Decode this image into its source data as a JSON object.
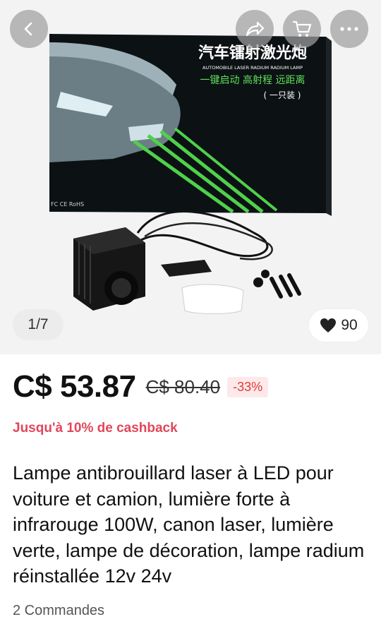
{
  "gallery": {
    "counter": "1/7",
    "likes": "90",
    "box_title_cn": "汽车镭射激光炮",
    "box_subtitle_en": "AUTOMOBILE LASER RADIUM RADIUM LAMP",
    "box_line2_cn": "一键启动 高射程 远距离",
    "box_line3_cn": "( 一只装 )",
    "box_cert": "FC CE RoHS"
  },
  "price": {
    "current": "C$ 53.87",
    "original": "C$ 80.40",
    "discount": "-33%"
  },
  "cashback": "Jusqu'à 10% de cashback",
  "product": {
    "title": "Lampe antibrouillard laser à LED pour voiture et camion, lumière forte à infrarouge 100W, canon laser, lumière verte, lampe de décoration, lampe radium réinstallée 12v 24v"
  },
  "orders": "2 Commandes",
  "colors": {
    "price_red": "#e4393c",
    "cashback": "#e0475a",
    "laser_green": "#4fd14a"
  },
  "icons": [
    "back-arrow-icon",
    "share-icon",
    "cart-icon",
    "more-icon",
    "heart-icon"
  ]
}
